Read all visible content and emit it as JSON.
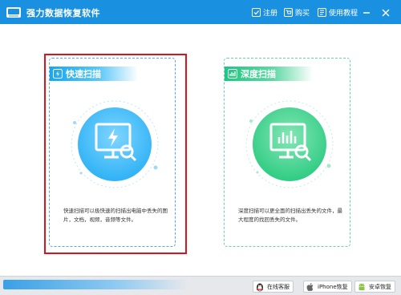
{
  "app": {
    "title": "强力数据恢复软件"
  },
  "titlebar": {
    "register_label": "注册",
    "buy_label": "购买",
    "tutorial_label": "使用教程"
  },
  "modes": {
    "fast": {
      "title": "快速扫描",
      "description": "快速扫描可以极快速的扫描出电脑中丢失的图片，文档，视频，音频等文件。",
      "selected": true,
      "accent": "#18a8ef"
    },
    "deep": {
      "title": "深度扫描",
      "description": "深度扫描可以更全面的扫描出丢失的文件，最大程度的找回丢失的文件。",
      "selected": false,
      "accent": "#1dc781"
    }
  },
  "footer": {
    "online_service_label": "在线客服",
    "iphone_recovery_label": "iPhone恢复",
    "android_recovery_label": "安卓恢复"
  },
  "colors": {
    "titlebar": "#1a90e0",
    "selection": "#d9141c"
  }
}
